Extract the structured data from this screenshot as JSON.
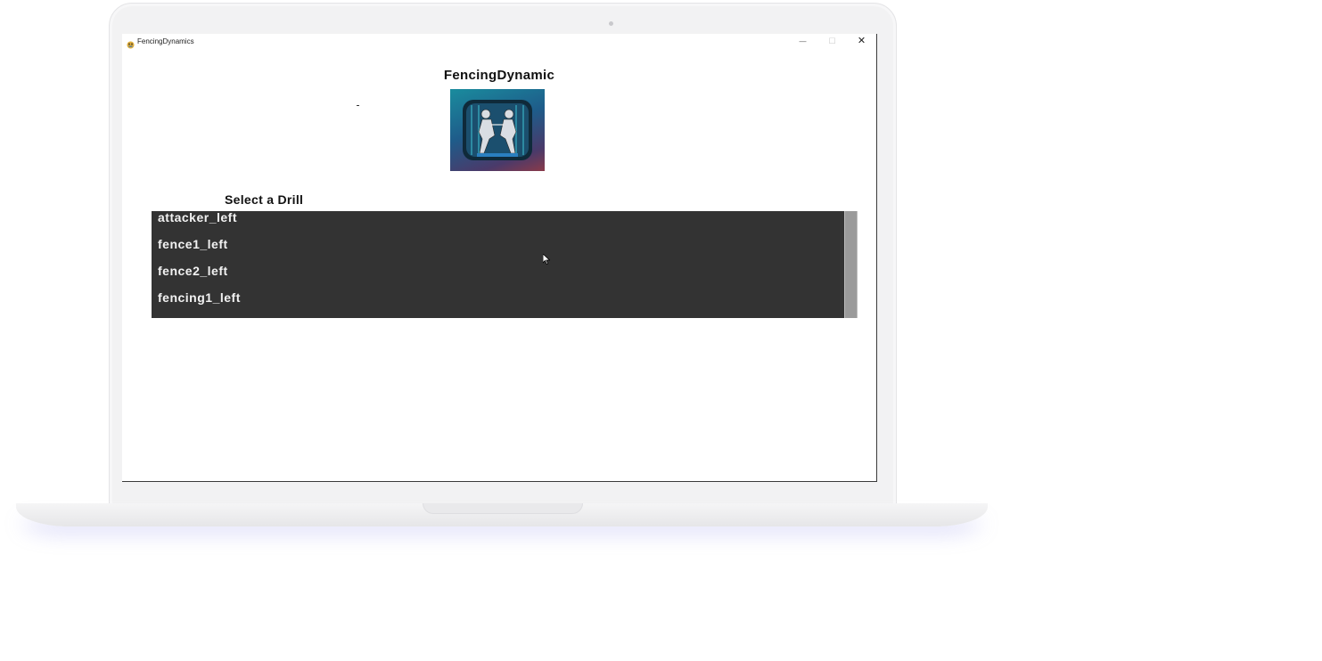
{
  "window": {
    "title": "FencingDynamics",
    "minimize_icon": "minimize-icon",
    "maximize_icon": "maximize-icon",
    "close_icon": "close-icon",
    "minimize_glyph": "—",
    "maximize_glyph": "☐",
    "close_glyph": "✕"
  },
  "app": {
    "heading": "FencingDynamic",
    "logo_icon": "fencers-logo-icon",
    "list_label": "Select a Drill"
  },
  "drills": [
    {
      "label": "attacker_left"
    },
    {
      "label": "fence1_left"
    },
    {
      "label": "fence2_left"
    },
    {
      "label": "fencing1_left"
    }
  ],
  "colors": {
    "list_background": "#333333",
    "list_text": "#f2f2f2",
    "scrollbar_thumb": "#9a9a9a"
  }
}
